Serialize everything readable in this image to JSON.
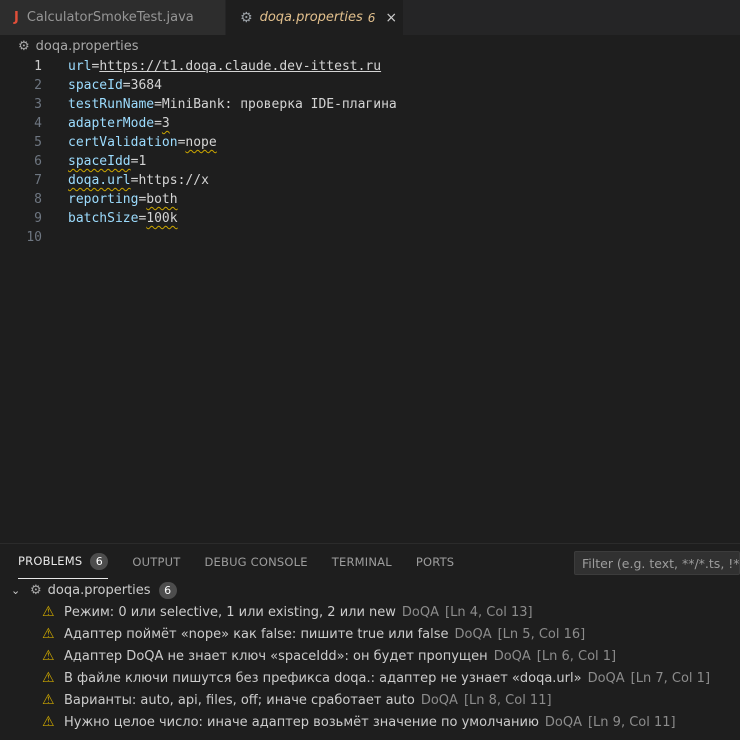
{
  "tabs": [
    {
      "icon": "J",
      "name": "CalculatorSmokeTest.java",
      "active": false
    },
    {
      "icon": "⚙",
      "name": "doqa.properties",
      "problems": "6",
      "close": "×",
      "active": true
    }
  ],
  "breadcrumb": {
    "file": "doqa.properties"
  },
  "editor": {
    "current_line": 1,
    "lines": [
      {
        "num": "1",
        "key": "url",
        "eq": "=",
        "value": "https://t1.doqa.claude.dev-ittest.ru"
      },
      {
        "num": "2",
        "key": "spaceId",
        "eq": "=",
        "value": "3684"
      },
      {
        "num": "3",
        "key": "testRunName",
        "eq": "=",
        "value": "MiniBank: проверка IDE-плагина"
      },
      {
        "num": "4",
        "key": "adapterMode",
        "eq": "=",
        "value": "3"
      },
      {
        "num": "5",
        "key": "certValidation",
        "eq": "=",
        "value": "nope"
      },
      {
        "num": "6",
        "key": "spaceIdd",
        "eq": "=",
        "value": "1"
      },
      {
        "num": "7",
        "key": "doqa.url",
        "eq": "=",
        "value": "https://x"
      },
      {
        "num": "8",
        "key": "reporting",
        "eq": "=",
        "value": "both"
      },
      {
        "num": "9",
        "key": "batchSize",
        "eq": "=",
        "value": "100k"
      },
      {
        "num": "10",
        "key": "",
        "eq": "",
        "value": ""
      }
    ]
  },
  "panel": {
    "tabs": [
      "PROBLEMS",
      "OUTPUT",
      "DEBUG CONSOLE",
      "TERMINAL",
      "PORTS"
    ],
    "problems_count": "6",
    "filter_placeholder": "Filter (e.g. text, **/*.ts, !**/node_modules/**)",
    "group": {
      "file": "doqa.properties",
      "count": "6"
    },
    "problems": [
      {
        "message": "Режим: 0 или selective, 1 или existing, 2 или new",
        "source": "DoQA",
        "location": "[Ln 4, Col 13]"
      },
      {
        "message": "Адаптер поймёт «nope» как false: пишите true или false",
        "source": "DoQA",
        "location": "[Ln 5, Col 16]"
      },
      {
        "message": "Адаптер DoQA не знает ключ «spaceIdd»: он будет пропущен",
        "source": "DoQA",
        "location": "[Ln 6, Col 1]"
      },
      {
        "message": "В файле ключи пишутся без префикса doqa.: адаптер не узнает «doqa.url»",
        "source": "DoQA",
        "location": "[Ln 7, Col 1]"
      },
      {
        "message": "Варианты: auto, api, files, off; иначе сработает auto",
        "source": "DoQA",
        "location": "[Ln 8, Col 11]"
      },
      {
        "message": "Нужно целое число: иначе адаптер возьмёт значение по умолчанию",
        "source": "DoQA",
        "location": "[Ln 9, Col 11]"
      }
    ]
  },
  "colors": {
    "warning": "#cca700",
    "key": "#9cdcfe",
    "active_tab_text": "#e2c08d",
    "java_icon": "#e04e39"
  }
}
